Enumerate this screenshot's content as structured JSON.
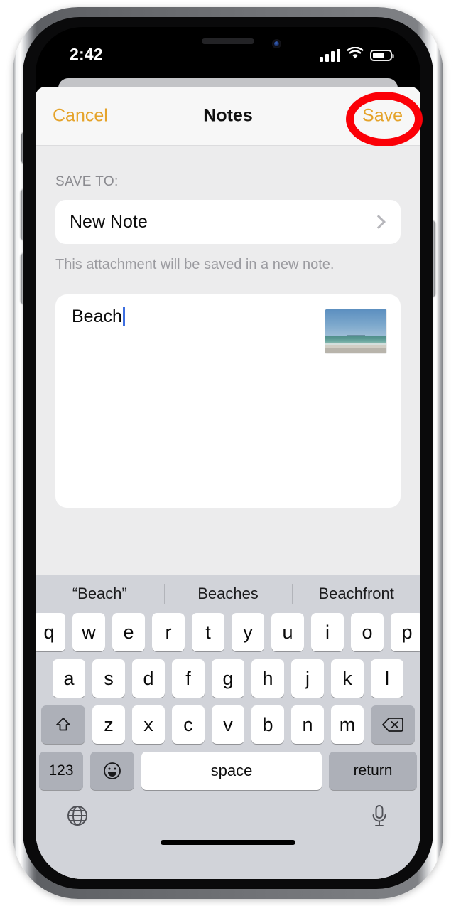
{
  "device": {
    "name": "iphone-silver",
    "frame_color": "#c9cbce"
  },
  "status_bar": {
    "time": "2:42",
    "signal_icon": "cellular-signal-icon",
    "wifi_icon": "wifi-icon",
    "battery_icon": "battery-icon",
    "battery_level_percent": 62
  },
  "navbar": {
    "cancel_label": "Cancel",
    "title": "Notes",
    "save_label": "Save",
    "tint_color": "#e5a32a"
  },
  "form": {
    "section_label": "SAVE TO:",
    "destination_value": "New Note",
    "chevron_icon": "chevron-right-icon",
    "hint": "This attachment will be saved in a new note."
  },
  "note": {
    "text": "Beach",
    "attachment_icon": "beach-photo-thumbnail"
  },
  "keyboard": {
    "suggestions": [
      "“Beach”",
      "Beaches",
      "Beachfront"
    ],
    "row1": [
      "q",
      "w",
      "e",
      "r",
      "t",
      "y",
      "u",
      "i",
      "o",
      "p"
    ],
    "row2": [
      "a",
      "s",
      "d",
      "f",
      "g",
      "h",
      "j",
      "k",
      "l"
    ],
    "row3": [
      "z",
      "x",
      "c",
      "v",
      "b",
      "n",
      "m"
    ],
    "shift_icon": "shift-icon",
    "backspace_icon": "backspace-icon",
    "numbers_label": "123",
    "emoji_icon": "emoji-smiley-icon",
    "space_label": "space",
    "return_label": "return",
    "globe_icon": "globe-icon",
    "microphone_icon": "microphone-icon"
  },
  "annotation": {
    "shape": "red-ellipse-highlight",
    "color": "#fb0007",
    "target": "Save"
  }
}
